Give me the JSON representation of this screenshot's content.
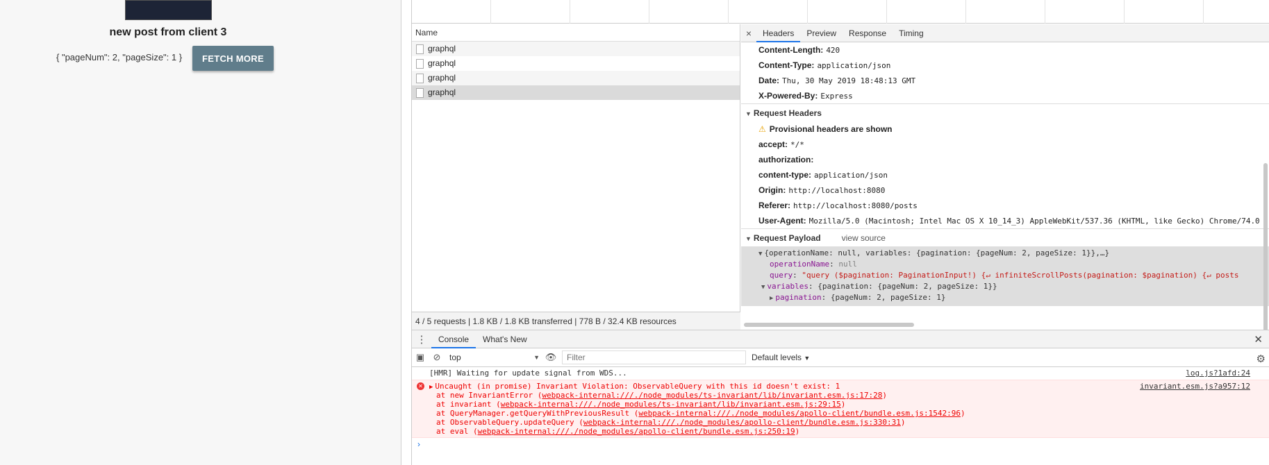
{
  "app": {
    "post_title": "new post from client 3",
    "page_info": "{ \"pageNum\": 2, \"pageSize\": 1 }",
    "fetch_button": "FETCH MORE"
  },
  "network": {
    "name_header": "Name",
    "requests": [
      "graphql",
      "graphql",
      "graphql",
      "graphql"
    ],
    "summary": "4 / 5 requests | 1.8 KB / 1.8 KB transferred | 778 B / 32.4 KB resources"
  },
  "detail": {
    "close": "×",
    "tabs": [
      "Headers",
      "Preview",
      "Response",
      "Timing"
    ],
    "response_headers": [
      {
        "name": "Content-Length:",
        "value": "420"
      },
      {
        "name": "Content-Type:",
        "value": "application/json"
      },
      {
        "name": "Date:",
        "value": "Thu, 30 May 2019 18:48:13 GMT"
      },
      {
        "name": "X-Powered-By:",
        "value": "Express"
      }
    ],
    "request_headers_title": "Request Headers",
    "provisional_warning": "Provisional headers are shown",
    "request_headers": [
      {
        "name": "accept:",
        "value": "*/*"
      },
      {
        "name": "authorization:",
        "value": ""
      },
      {
        "name": "content-type:",
        "value": "application/json"
      },
      {
        "name": "Origin:",
        "value": "http://localhost:8080"
      },
      {
        "name": "Referer:",
        "value": "http://localhost:8080/posts"
      },
      {
        "name": "User-Agent:",
        "value": "Mozilla/5.0 (Macintosh; Intel Mac OS X 10_14_3) AppleWebKit/537.36 (KHTML, like Gecko) Chrome/74.0"
      }
    ],
    "payload_title": "Request Payload",
    "view_source": "view source",
    "payload": {
      "summary": "{operationName: null, variables: {pagination: {pageNum: 2, pageSize: 1}},…}",
      "operation_key": "operationName",
      "operation_val": "null",
      "query_key": "query",
      "query_val": "\"query ($pagination: PaginationInput!) {↵  infiniteScrollPosts(pagination: $pagination) {↵    posts",
      "variables_key": "variables",
      "variables_val": "{pagination: {pageNum: 2, pageSize: 1}}",
      "pagination_key": "pagination",
      "pagination_val": "{pageNum: 2, pageSize: 1}"
    }
  },
  "console": {
    "tabs": [
      "Console",
      "What's New"
    ],
    "context": "top",
    "filter_placeholder": "Filter",
    "levels": "Default levels",
    "hmr_message": "[HMR] Waiting for update signal from WDS...",
    "hmr_source": "log.js?1afd:24",
    "error_source": "invariant.esm.js?a957:12",
    "error_title": "Uncaught (in promise) Invariant Violation: ObservableQuery with this id doesn't exist: 1",
    "stack": [
      {
        "prefix": "at new InvariantError (",
        "link": "webpack-internal:///./node_modules/ts-invariant/lib/invariant.esm.js:17:28",
        "suffix": ")"
      },
      {
        "prefix": "at invariant (",
        "link": "webpack-internal:///./node_modules/ts-invariant/lib/invariant.esm.js:29:15",
        "suffix": ")"
      },
      {
        "prefix": "at QueryManager.getQueryWithPreviousResult (",
        "link": "webpack-internal:///./node_modules/apollo-client/bundle.esm.js:1542:96",
        "suffix": ")"
      },
      {
        "prefix": "at ObservableQuery.updateQuery (",
        "link": "webpack-internal:///./node_modules/apollo-client/bundle.esm.js:330:31",
        "suffix": ")"
      },
      {
        "prefix": "at eval (",
        "link": "webpack-internal:///./node_modules/apollo-client/bundle.esm.js:250:19",
        "suffix": ")"
      }
    ],
    "prompt": "›"
  }
}
